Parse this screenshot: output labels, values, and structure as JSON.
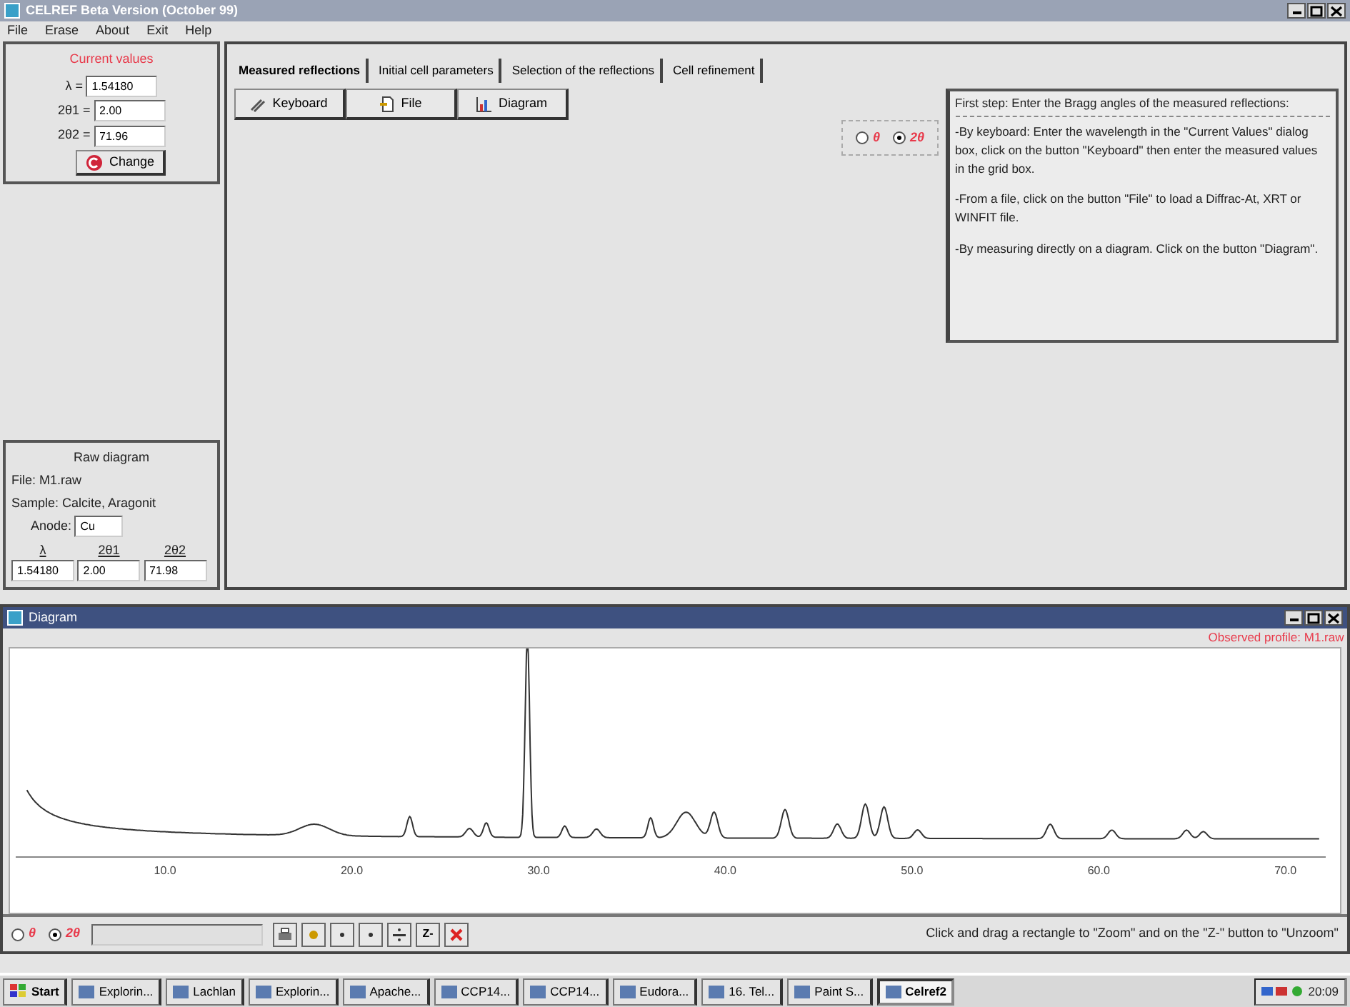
{
  "window": {
    "title": "CELREF Beta Version (October 99)"
  },
  "menu": [
    "File",
    "Erase",
    "About",
    "Exit",
    "Help"
  ],
  "current_values": {
    "title": "Current values",
    "fields": [
      {
        "label": "λ =",
        "value": "1.54180"
      },
      {
        "label": "2θ1 =",
        "value": "2.00"
      },
      {
        "label": "2θ2 =",
        "value": "71.96"
      }
    ],
    "button": "Change"
  },
  "raw_diagram": {
    "title": "Raw diagram",
    "file": "File: M1.raw",
    "sample": "Sample: Calcite, Aragonit",
    "anode_label": "Anode:",
    "anode_value": "Cu",
    "columns": [
      {
        "label": "λ",
        "value": "1.54180"
      },
      {
        "label": "2θ1",
        "value": "2.00"
      },
      {
        "label": "2θ2",
        "value": "71.98"
      }
    ]
  },
  "tabs": [
    {
      "label": "Measured reflections",
      "selected": true
    },
    {
      "label": "Initial cell parameters",
      "selected": false
    },
    {
      "label": "Selection of the reflections",
      "selected": false
    },
    {
      "label": "Cell refinement",
      "selected": false
    }
  ],
  "source_buttons": [
    "Keyboard",
    "File",
    "Diagram"
  ],
  "angle_mode": [
    {
      "label": "θ",
      "selected": false
    },
    {
      "label": "2θ",
      "selected": true
    }
  ],
  "help_text": [
    "First step: Enter the Bragg angles of the measured reflections:",
    "-By keyboard: Enter the wavelength in the \"Current Values\" dialog box, click on the button \"Keyboard\" then enter the measured values in the grid box.",
    "-From a file, click on the button \"File\" to load a Diffrac-At, XRT or WINFIT file.",
    "-By measuring directly on a diagram. Click on the button \"Diagram\"."
  ],
  "diagram_window": {
    "title": "Diagram",
    "profile_label": "Observed profile: M1.raw",
    "x_tick_labels": [
      "10.0",
      "20.0",
      "30.0",
      "40.0",
      "50.0",
      "60.0",
      "70.0"
    ],
    "angle_mode": [
      {
        "label": "θ",
        "selected": false
      },
      {
        "label": "2θ",
        "selected": true
      }
    ],
    "zoom_out_button": "Z-",
    "hint": "Click and drag a rectangle to \"Zoom\" and on the \"Z-\" button to \"Unzoom\""
  },
  "taskbar": {
    "start": "Start",
    "items": [
      {
        "label": "Explorin...",
        "selected": false
      },
      {
        "label": "Lachlan",
        "selected": false
      },
      {
        "label": "Explorin...",
        "selected": false
      },
      {
        "label": "Apache...",
        "selected": false
      },
      {
        "label": "CCP14...",
        "selected": false
      },
      {
        "label": "CCP14...",
        "selected": false
      },
      {
        "label": "Eudora...",
        "selected": false
      },
      {
        "label": "16. Tel...",
        "selected": false
      },
      {
        "label": "Paint S...",
        "selected": false
      },
      {
        "label": "Celref2",
        "selected": true
      }
    ],
    "clock": "20:09"
  }
}
